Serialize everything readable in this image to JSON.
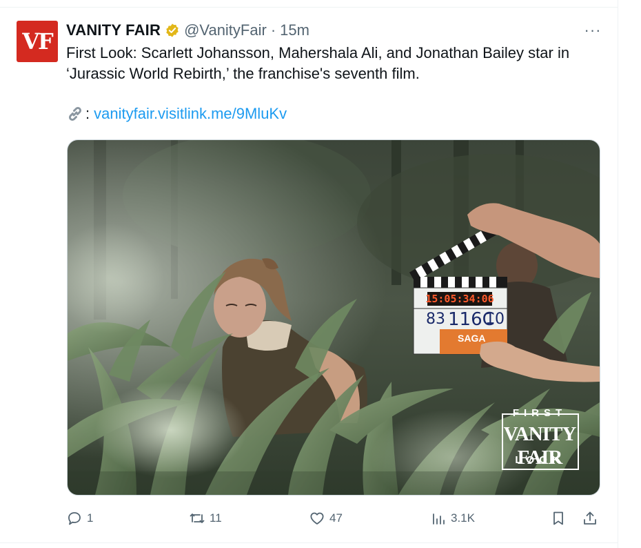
{
  "post": {
    "author": {
      "display_name": "VANITY FAIR",
      "handle": "@VanityFair",
      "separator": "·",
      "time": "15m",
      "verified": true,
      "avatar_text": "VF",
      "avatar_color": "#d42a20",
      "badge_color": "#e2b719"
    },
    "more_label": "···",
    "text_line1": "First Look: Scarlett Johansson, Mahershala Ali, and Jonathan Bailey star in",
    "text_line2": "‘Jurassic World Rebirth,’ the franchise's seventh film.",
    "link": {
      "icon": "link-emoji-icon",
      "colon": ":",
      "url": "vanityfair.visitlink.me/9MluKv",
      "color": "#1d9bf0"
    },
    "media": {
      "clapper": {
        "timecode": "15:05:34:06",
        "roll": "83",
        "scene": "116C",
        "take": "10",
        "brand": "SAGA"
      },
      "watermark": {
        "top": "FIRST",
        "middle": "VANITY FAIR",
        "bottom": "LOOK"
      }
    },
    "actions": {
      "replies": "1",
      "reposts": "11",
      "likes": "47",
      "views": "3.1K"
    }
  }
}
